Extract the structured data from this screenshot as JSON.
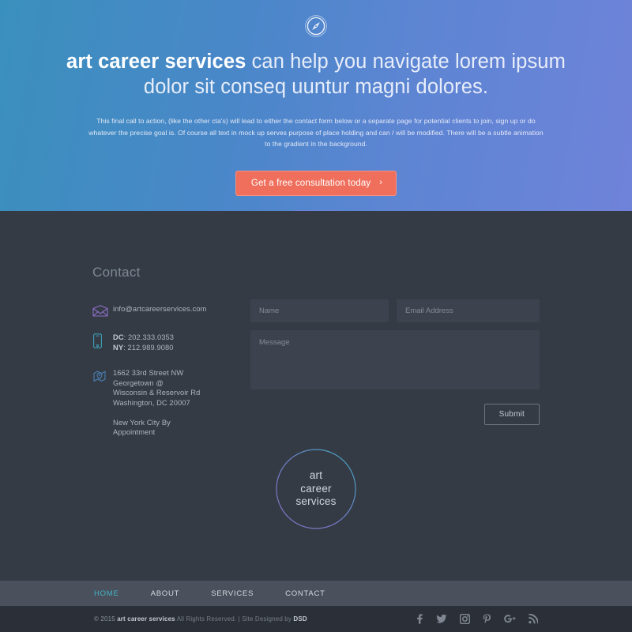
{
  "hero": {
    "icon": "compass-icon",
    "title_brand": "art career services",
    "title_rest": " can help you navigate lorem ipsum dolor sit conseq uuntur magni dolores.",
    "subtext": "This final call to action, (like the other cta's) will lead to either the contact form below or a separate page for potential clients to join, sign up or do whatever the precise goal is. Of course all text in mock up serves purpose of place holding and can / will be modified. There will be a subtle animation to the gradient in the background.",
    "cta_label": "Get a free consultation today",
    "cta_chevron": "›",
    "bg_start": "#3a90bd",
    "bg_end": "#6f83d9",
    "cta_color": "#ef6f5c"
  },
  "contact": {
    "heading": "Contact",
    "email": "info@artcareerservices.com",
    "email_icon": "envelope-icon",
    "phone_icon": "mobile-phone-icon",
    "phone_dc_label": "DC",
    "phone_dc_value": ": 202.333.0353",
    "phone_ny_label": "NY",
    "phone_ny_value": ": 212.989.9080",
    "address_icon": "map-pin-icon",
    "address_line1": "1662 33rd Street NW",
    "address_line2": "Georgetown @",
    "address_line3": "Wisconsin & Reservoir Rd",
    "address_line4": "Washington, DC 20007",
    "address_line5": "New York City By",
    "address_line6": "Appointment"
  },
  "form": {
    "name_placeholder": "Name",
    "email_placeholder": "Email Address",
    "message_placeholder": "Message",
    "name_value": "",
    "email_value": "",
    "message_value": "",
    "submit_label": "Submit"
  },
  "logo": {
    "line1": "art",
    "line2": "career",
    "line3": "services",
    "ring_start": "#8a6fc0",
    "ring_end": "#3fa9bd"
  },
  "footer_nav": {
    "items": [
      {
        "label": "HOME",
        "active": true
      },
      {
        "label": "ABOUT",
        "active": false
      },
      {
        "label": "SERVICES",
        "active": false
      },
      {
        "label": "CONTACT",
        "active": false
      }
    ],
    "active_color": "#45b0c4"
  },
  "copyright": {
    "symbol_year": "© 2015 ",
    "brand": "art career services",
    "rights": " All Rights Reserved.",
    "divider": "  |  ",
    "designed_by": "Site Designed by ",
    "designer": "DSD",
    "social": [
      {
        "name": "facebook-icon"
      },
      {
        "name": "twitter-icon"
      },
      {
        "name": "instagram-icon"
      },
      {
        "name": "pinterest-icon"
      },
      {
        "name": "google-plus-icon"
      },
      {
        "name": "rss-icon"
      }
    ]
  }
}
